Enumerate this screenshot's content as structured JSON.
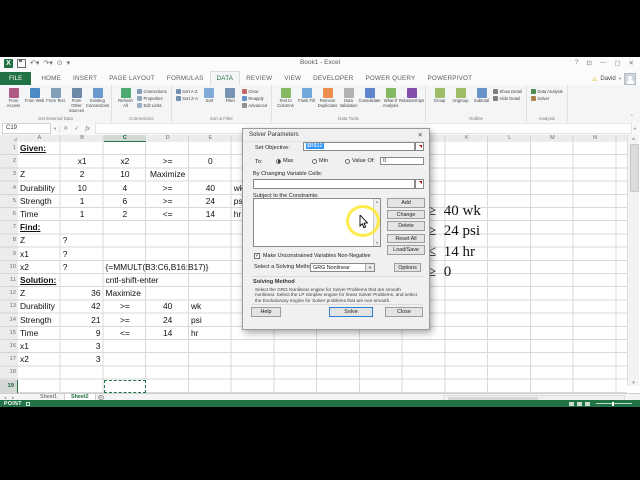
{
  "titlebar": {
    "title": "Book1 - Excel",
    "window_controls": [
      {
        "name": "help-icon",
        "glyph": "?"
      },
      {
        "name": "ribbon-display-options-icon",
        "glyph": "⊡"
      },
      {
        "name": "minimize-icon",
        "glyph": "—"
      },
      {
        "name": "restore-icon",
        "glyph": "▢"
      },
      {
        "name": "close-icon",
        "glyph": "✕"
      }
    ]
  },
  "tab_row": {
    "file_tab": "FILE",
    "tabs": [
      {
        "label": "HOME"
      },
      {
        "label": "INSERT"
      },
      {
        "label": "PAGE LAYOUT"
      },
      {
        "label": "FORMULAS"
      },
      {
        "label": "DATA",
        "active": true
      },
      {
        "label": "REVIEW"
      },
      {
        "label": "VIEW"
      },
      {
        "label": "DEVELOPER"
      },
      {
        "label": "POWER QUERY"
      },
      {
        "label": "POWERPIVOT"
      }
    ],
    "account_name": "David"
  },
  "ribbon": {
    "groups": [
      {
        "label": "Get External Data",
        "items": [
          {
            "b": {
              "l": "From Access",
              "ic": "database-icon",
              "c": "#a3406e"
            }
          },
          {
            "b": {
              "l": "From Web",
              "ic": "globe-icon",
              "c": "#2e77bc"
            }
          },
          {
            "b": {
              "l": "From Text",
              "ic": "text-file-icon",
              "c": "#6f8fae"
            }
          },
          {
            "b": {
              "l": "From Other Sources",
              "ic": "sources-icon",
              "c": "#54759a"
            }
          },
          {
            "b": {
              "l": "Existing Connections",
              "ic": "connections-file-icon",
              "c": "#4f87c6"
            }
          }
        ]
      },
      {
        "label": "Connections",
        "items": [
          {
            "b": {
              "l": "Refresh All",
              "ic": "refresh-icon",
              "c": "#2e9b57"
            }
          },
          {
            "s": [
              {
                "l": "Connections",
                "ic": "connections-icon",
                "c": "#6b8cae"
              },
              {
                "l": "Properties",
                "ic": "properties-icon",
                "c": "#7f98b0"
              },
              {
                "l": "Edit Links",
                "ic": "edit-links-icon",
                "c": "#8aa2b8"
              }
            ]
          }
        ]
      },
      {
        "label": "Sort & Filter",
        "items": [
          {
            "s": [
              {
                "l": "Sort A-Z",
                "ic": "sort-asc-icon",
                "c": "#5b7fa6"
              },
              {
                "l": "Sort Z-A",
                "ic": "sort-desc-icon",
                "c": "#5b7fa6"
              }
            ]
          },
          {
            "b": {
              "l": "Sort",
              "ic": "sort-icon",
              "c": "#6c9bd2"
            }
          },
          {
            "b": {
              "l": "Filter",
              "ic": "filter-icon",
              "c": "#5e82a8"
            }
          },
          {
            "s": [
              {
                "l": "Clear",
                "ic": "clear-icon",
                "c": "#c0504d"
              },
              {
                "l": "Reapply",
                "ic": "reapply-icon",
                "c": "#4f81bd"
              },
              {
                "l": "Advanced",
                "ic": "advanced-icon",
                "c": "#7f7f7f"
              }
            ]
          }
        ]
      },
      {
        "label": "Data Tools",
        "items": [
          {
            "b": {
              "l": "Text to Columns",
              "ic": "text-to-columns-icon",
              "c": "#70ad47"
            }
          },
          {
            "b": {
              "l": "Flash Fill",
              "ic": "flash-fill-icon",
              "c": "#5b9bd5"
            }
          },
          {
            "b": {
              "l": "Remove Duplicates",
              "ic": "remove-duplicates-icon",
              "c": "#ed7d31"
            }
          },
          {
            "b": {
              "l": "Data Validation",
              "ic": "data-validation-icon",
              "c": "#a5a5a5"
            }
          },
          {
            "b": {
              "l": "Consolidate",
              "ic": "consolidate-icon",
              "c": "#4472c4"
            }
          },
          {
            "b": {
              "l": "What-If Analysis",
              "ic": "what-if-icon",
              "c": "#70ad47"
            }
          },
          {
            "b": {
              "l": "Relationships",
              "ic": "relationships-icon",
              "c": "#7030a0"
            }
          }
        ]
      },
      {
        "label": "Outline",
        "items": [
          {
            "b": {
              "l": "Group",
              "ic": "group-icon",
              "c": "#8db44a"
            }
          },
          {
            "b": {
              "l": "Ungroup",
              "ic": "ungroup-icon",
              "c": "#8db44a"
            }
          },
          {
            "b": {
              "l": "Subtotal",
              "ic": "subtotal-icon",
              "c": "#4f81bd"
            }
          },
          {
            "s": [
              {
                "l": "Show Detail",
                "ic": "show-detail-icon",
                "c": "#6a6a6a"
              },
              {
                "l": "Hide Detail",
                "ic": "hide-detail-icon",
                "c": "#6a6a6a"
              }
            ]
          }
        ]
      },
      {
        "label": "Analysis",
        "items": [
          {
            "s": [
              {
                "l": "Data Analysis",
                "ic": "data-analysis-icon",
                "c": "#31752f"
              },
              {
                "l": "Solver",
                "ic": "solver-icon",
                "c": "#a06a2c"
              }
            ]
          }
        ]
      }
    ]
  },
  "formula_bar": {
    "name_box": "C19",
    "buttons": [
      {
        "name": "cancel-icon",
        "glyph": "✕"
      },
      {
        "name": "enter-icon",
        "glyph": "✓"
      },
      {
        "name": "insert-function-icon",
        "glyph": "fx"
      }
    ],
    "formula_value": ""
  },
  "grid": {
    "columns": [
      "A",
      "B",
      "C",
      "D",
      "E",
      "F",
      "G",
      "H",
      "I",
      "J",
      "K",
      "L",
      "M",
      "N"
    ],
    "selected_column": "C",
    "rows": 19,
    "active_row": 19,
    "active_cell": "C19",
    "cells": [
      {
        "r": 1,
        "c": "A",
        "t": "Given:",
        "s": "h"
      },
      {
        "r": 2,
        "c": "B",
        "t": "x1",
        "a": "c"
      },
      {
        "r": 2,
        "c": "C",
        "t": "x2",
        "a": "c"
      },
      {
        "r": 2,
        "c": "D",
        "t": ">=",
        "a": "c"
      },
      {
        "r": 2,
        "c": "E",
        "t": "0",
        "a": "c"
      },
      {
        "r": 3,
        "c": "A",
        "t": "Z"
      },
      {
        "r": 3,
        "c": "B",
        "t": "2",
        "a": "c"
      },
      {
        "r": 3,
        "c": "C",
        "t": "10",
        "a": "c"
      },
      {
        "r": 3,
        "c": "D",
        "t": "Maximize",
        "a": "c"
      },
      {
        "r": 4,
        "c": "A",
        "t": "Durability"
      },
      {
        "r": 4,
        "c": "B",
        "t": "10",
        "a": "c"
      },
      {
        "r": 4,
        "c": "C",
        "t": "4",
        "a": "c"
      },
      {
        "r": 4,
        "c": "D",
        "t": ">=",
        "a": "c"
      },
      {
        "r": 4,
        "c": "E",
        "t": "40",
        "a": "c"
      },
      {
        "r": 4,
        "c": "F",
        "t": "wk"
      },
      {
        "r": 5,
        "c": "A",
        "t": "Strength"
      },
      {
        "r": 5,
        "c": "B",
        "t": "1",
        "a": "c"
      },
      {
        "r": 5,
        "c": "C",
        "t": "6",
        "a": "c"
      },
      {
        "r": 5,
        "c": "D",
        "t": ">=",
        "a": "c"
      },
      {
        "r": 5,
        "c": "E",
        "t": "24",
        "a": "c"
      },
      {
        "r": 5,
        "c": "F",
        "t": "psi"
      },
      {
        "r": 6,
        "c": "A",
        "t": "Time"
      },
      {
        "r": 6,
        "c": "B",
        "t": "1",
        "a": "c"
      },
      {
        "r": 6,
        "c": "C",
        "t": "2",
        "a": "c"
      },
      {
        "r": 6,
        "c": "D",
        "t": "<=",
        "a": "c"
      },
      {
        "r": 6,
        "c": "E",
        "t": "14",
        "a": "c"
      },
      {
        "r": 6,
        "c": "F",
        "t": "hr"
      },
      {
        "r": 7,
        "c": "A",
        "t": "Find:",
        "s": "h"
      },
      {
        "r": 8,
        "c": "A",
        "t": "Z"
      },
      {
        "r": 8,
        "c": "B",
        "t": "?"
      },
      {
        "r": 9,
        "c": "A",
        "t": "x1"
      },
      {
        "r": 9,
        "c": "B",
        "t": "?"
      },
      {
        "r": 10,
        "c": "A",
        "t": "x2"
      },
      {
        "r": 10,
        "c": "B",
        "t": "?"
      },
      {
        "r": 10,
        "c": "C",
        "t": "{=MMULT(B3:C6,B16:B17)}"
      },
      {
        "r": 11,
        "c": "A",
        "t": "Solution:",
        "s": "h"
      },
      {
        "r": 11,
        "c": "C",
        "t": "cntl-shift-enter"
      },
      {
        "r": 12,
        "c": "A",
        "t": "Z"
      },
      {
        "r": 12,
        "c": "B",
        "t": "36",
        "a": "r"
      },
      {
        "r": 12,
        "c": "C",
        "t": "Maximize"
      },
      {
        "r": 13,
        "c": "A",
        "t": "Durability"
      },
      {
        "r": 13,
        "c": "B",
        "t": "42",
        "a": "r"
      },
      {
        "r": 13,
        "c": "C",
        "t": ">=",
        "a": "c"
      },
      {
        "r": 13,
        "c": "D",
        "t": "40",
        "a": "c"
      },
      {
        "r": 13,
        "c": "E",
        "t": "wk"
      },
      {
        "r": 14,
        "c": "A",
        "t": "Strength"
      },
      {
        "r": 14,
        "c": "B",
        "t": "21",
        "a": "r"
      },
      {
        "r": 14,
        "c": "C",
        "t": ">=",
        "a": "c"
      },
      {
        "r": 14,
        "c": "D",
        "t": "24",
        "a": "c"
      },
      {
        "r": 14,
        "c": "E",
        "t": "psi"
      },
      {
        "r": 15,
        "c": "A",
        "t": "Time"
      },
      {
        "r": 15,
        "c": "B",
        "t": "9",
        "a": "r"
      },
      {
        "r": 15,
        "c": "C",
        "t": "<=",
        "a": "c"
      },
      {
        "r": 15,
        "c": "D",
        "t": "14",
        "a": "c"
      },
      {
        "r": 15,
        "c": "E",
        "t": "hr"
      },
      {
        "r": 16,
        "c": "A",
        "t": "x1"
      },
      {
        "r": 16,
        "c": "B",
        "t": "3",
        "a": "r"
      },
      {
        "r": 17,
        "c": "A",
        "t": "x2"
      },
      {
        "r": 17,
        "c": "B",
        "t": "3",
        "a": "r"
      }
    ],
    "equations_overlay": [
      {
        "t": "≥  40 wk"
      },
      {
        "t": "≥  24 psi"
      },
      {
        "t": "≤  14 hr"
      },
      {
        "t": "≥  0"
      }
    ]
  },
  "solver": {
    "title": "Solver Parameters",
    "close_glyph": "✕",
    "set_objective_label": "Set Objective:",
    "objective_value": "$B$12",
    "to_label": "To:",
    "radio_max": "Max",
    "radio_min": "Min",
    "radio_value_of": "Value Of:",
    "value_of": "0",
    "by_changing_label": "By Changing Variable Cells:",
    "subject_label": "Subject to the Constraints:",
    "btn_add": "Add",
    "btn_change": "Change",
    "btn_delete": "Delete",
    "btn_reset": "Reset All",
    "btn_load": "Load/Save",
    "checkbox_label": "Make Unconstrained Variables Non-Negative",
    "checkbox_glyph": "✓",
    "method_label": "Select a Solving Method:",
    "method_value": "GRG Nonlinear",
    "btn_options": "Options",
    "solving_heading": "Solving Method",
    "solving_desc": "Select the GRG Nonlinear engine for Solver Problems that are smooth nonlinear. Select the LP Simplex engine for linear Solver Problems, and select the Evolutionary engine for Solver problems that are non-smooth.",
    "btn_help": "Help",
    "btn_solve": "Solve",
    "btn_close": "Close"
  },
  "sheet_tabs": {
    "tabs": [
      {
        "label": "Sheet1"
      },
      {
        "label": "Sheet2",
        "active": true
      }
    ]
  },
  "status_bar": {
    "mode": "POINT"
  },
  "colors": {
    "excel_green": "#217346",
    "selection_blue": "#3297fd",
    "highlight_ring_yellow": "#ffe82d"
  }
}
